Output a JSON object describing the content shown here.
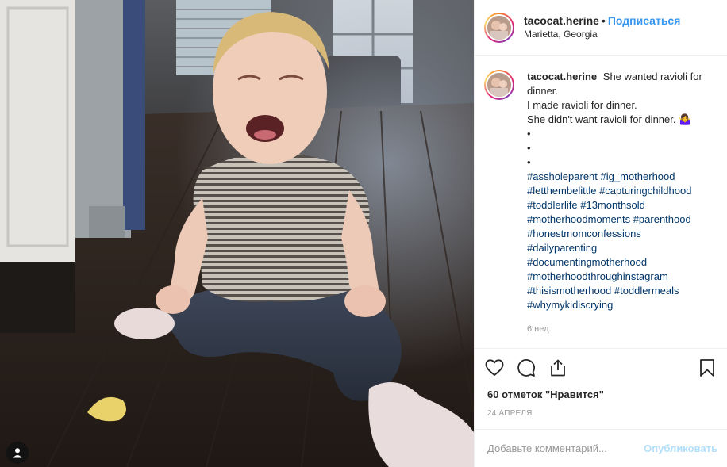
{
  "post": {
    "username": "tacocat.herine",
    "separator": "•",
    "follow_label": "Подписаться",
    "location": "Marietta, Georgia"
  },
  "caption": {
    "username": "tacocat.herine",
    "lines": [
      "She wanted ravioli for dinner.",
      "I made ravioli for dinner.",
      "She didn't want ravioli for dinner. 🤷‍♀️",
      "•",
      "•",
      "•"
    ],
    "hashtags": [
      "#assholeparent",
      "#ig_motherhood",
      "#letthembelittle",
      "#capturingchildhood",
      "#toddlerlife",
      "#13monthsold",
      "#motherhoodmoments",
      "#parenthood",
      "#honestmomconfessions",
      "#dailyparenting",
      "#documentingmotherhood",
      "#motherhoodthroughinstagram",
      "#thisismotherhood",
      "#toddlermeals",
      "#whymykidiscrying"
    ],
    "time_ago": "6 нед."
  },
  "actions": {
    "like_icon": "heart-icon",
    "comment_icon": "comment-icon",
    "share_icon": "share-icon",
    "save_icon": "bookmark-icon"
  },
  "likes_text": "60 отметок \"Нравится\"",
  "date_text": "24 АПРЕЛЯ",
  "comment_box": {
    "placeholder": "Добавьте комментарий...",
    "publish_label": "Опубликовать"
  },
  "colors": {
    "link_blue": "#3897f0",
    "hashtag_blue": "#003569",
    "publish_disabled": "#b2dffc",
    "muted": "#999999"
  }
}
